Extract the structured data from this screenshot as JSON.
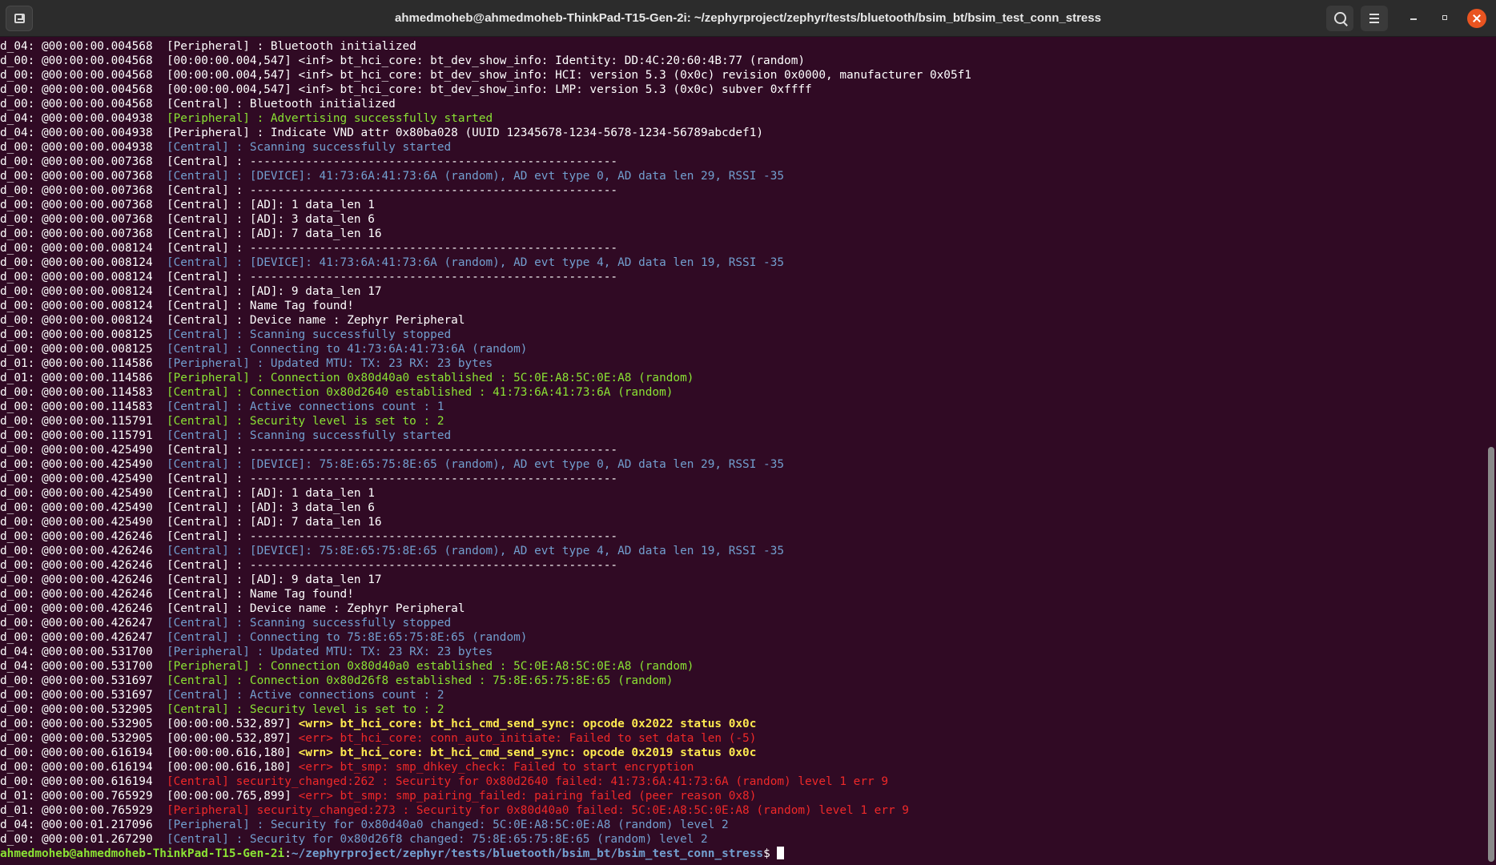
{
  "window": {
    "title": "ahmedmoheb@ahmedmoheb-ThinkPad-T15-Gen-2i: ~/zephyrproject/zephyr/tests/bluetooth/bsim_bt/bsim_test_conn_stress"
  },
  "icons": {
    "new_tab": "new-tab-icon",
    "search": "search-icon",
    "menu": "hamburger-menu-icon",
    "minimize": "minimize-icon",
    "maximize": "maximize-icon",
    "close": "close-icon"
  },
  "colors": {
    "background": "#300a24",
    "titlebar": "#2c2c2c",
    "green": "#8ae234",
    "blue": "#729fcf",
    "yellow": "#fce94f",
    "red": "#ef2929",
    "close_button": "#e95420"
  },
  "terminal": {
    "lines": [
      {
        "prefix": "d_04: @00:00:00.004568  ",
        "text": "[Peripheral] : Bluetooth initialized",
        "color": "white"
      },
      {
        "prefix": "d_00: @00:00:00.004568  ",
        "text": "[00:00:00.004,547] <inf> bt_hci_core: bt_dev_show_info: Identity: DD:4C:20:60:4B:77 (random)",
        "color": "white"
      },
      {
        "prefix": "d_00: @00:00:00.004568  ",
        "text": "[00:00:00.004,547] <inf> bt_hci_core: bt_dev_show_info: HCI: version 5.3 (0x0c) revision 0x0000, manufacturer 0x05f1",
        "color": "white"
      },
      {
        "prefix": "d_00: @00:00:00.004568  ",
        "text": "[00:00:00.004,547] <inf> bt_hci_core: bt_dev_show_info: LMP: version 5.3 (0x0c) subver 0xffff",
        "color": "white"
      },
      {
        "prefix": "d_00: @00:00:00.004568  ",
        "text": "[Central] : Bluetooth initialized",
        "color": "white"
      },
      {
        "prefix": "d_04: @00:00:00.004938  ",
        "text": "[Peripheral] : Advertising successfully started",
        "color": "green"
      },
      {
        "prefix": "d_04: @00:00:00.004938  ",
        "text": "[Peripheral] : Indicate VND attr 0x80ba028 (UUID 12345678-1234-5678-1234-56789abcdef1)",
        "color": "white"
      },
      {
        "prefix": "d_00: @00:00:00.004938  ",
        "text": "[Central] : Scanning successfully started",
        "color": "blue"
      },
      {
        "prefix": "d_00: @00:00:00.007368  ",
        "text": "[Central] : -----------------------------------------------------",
        "color": "white"
      },
      {
        "prefix": "d_00: @00:00:00.007368  ",
        "text": "[Central] : [DEVICE]: 41:73:6A:41:73:6A (random), AD evt type 0, AD data len 29, RSSI -35",
        "color": "blue"
      },
      {
        "prefix": "d_00: @00:00:00.007368  ",
        "text": "[Central] : -----------------------------------------------------",
        "color": "white"
      },
      {
        "prefix": "d_00: @00:00:00.007368  ",
        "text": "[Central] : [AD]: 1 data_len 1",
        "color": "white"
      },
      {
        "prefix": "d_00: @00:00:00.007368  ",
        "text": "[Central] : [AD]: 3 data_len 6",
        "color": "white"
      },
      {
        "prefix": "d_00: @00:00:00.007368  ",
        "text": "[Central] : [AD]: 7 data_len 16",
        "color": "white"
      },
      {
        "prefix": "d_00: @00:00:00.008124  ",
        "text": "[Central] : -----------------------------------------------------",
        "color": "white"
      },
      {
        "prefix": "d_00: @00:00:00.008124  ",
        "text": "[Central] : [DEVICE]: 41:73:6A:41:73:6A (random), AD evt type 4, AD data len 19, RSSI -35",
        "color": "blue"
      },
      {
        "prefix": "d_00: @00:00:00.008124  ",
        "text": "[Central] : -----------------------------------------------------",
        "color": "white"
      },
      {
        "prefix": "d_00: @00:00:00.008124  ",
        "text": "[Central] : [AD]: 9 data_len 17",
        "color": "white"
      },
      {
        "prefix": "d_00: @00:00:00.008124  ",
        "text": "[Central] : Name Tag found!",
        "color": "white"
      },
      {
        "prefix": "d_00: @00:00:00.008124  ",
        "text": "[Central] : Device name : Zephyr Peripheral",
        "color": "white"
      },
      {
        "prefix": "d_00: @00:00:00.008125  ",
        "text": "[Central] : Scanning successfully stopped",
        "color": "blue"
      },
      {
        "prefix": "d_00: @00:00:00.008125  ",
        "text": "[Central] : Connecting to 41:73:6A:41:73:6A (random)",
        "color": "blue"
      },
      {
        "prefix": "d_01: @00:00:00.114586  ",
        "text": "[Peripheral] : Updated MTU: TX: 23 RX: 23 bytes",
        "color": "blue"
      },
      {
        "prefix": "d_01: @00:00:00.114586  ",
        "text": "[Peripheral] : Connection 0x80d40a0 established : 5C:0E:A8:5C:0E:A8 (random)",
        "color": "green"
      },
      {
        "prefix": "d_00: @00:00:00.114583  ",
        "text": "[Central] : Connection 0x80d2640 established : 41:73:6A:41:73:6A (random)",
        "color": "green"
      },
      {
        "prefix": "d_00: @00:00:00.114583  ",
        "text": "[Central] : Active connections count : 1",
        "color": "blue"
      },
      {
        "prefix": "d_00: @00:00:00.115791  ",
        "text": "[Central] : Security level is set to : 2",
        "color": "green"
      },
      {
        "prefix": "d_00: @00:00:00.115791  ",
        "text": "[Central] : Scanning successfully started",
        "color": "blue"
      },
      {
        "prefix": "d_00: @00:00:00.425490  ",
        "text": "[Central] : -----------------------------------------------------",
        "color": "white"
      },
      {
        "prefix": "d_00: @00:00:00.425490  ",
        "text": "[Central] : [DEVICE]: 75:8E:65:75:8E:65 (random), AD evt type 0, AD data len 29, RSSI -35",
        "color": "blue"
      },
      {
        "prefix": "d_00: @00:00:00.425490  ",
        "text": "[Central] : -----------------------------------------------------",
        "color": "white"
      },
      {
        "prefix": "d_00: @00:00:00.425490  ",
        "text": "[Central] : [AD]: 1 data_len 1",
        "color": "white"
      },
      {
        "prefix": "d_00: @00:00:00.425490  ",
        "text": "[Central] : [AD]: 3 data_len 6",
        "color": "white"
      },
      {
        "prefix": "d_00: @00:00:00.425490  ",
        "text": "[Central] : [AD]: 7 data_len 16",
        "color": "white"
      },
      {
        "prefix": "d_00: @00:00:00.426246  ",
        "text": "[Central] : -----------------------------------------------------",
        "color": "white"
      },
      {
        "prefix": "d_00: @00:00:00.426246  ",
        "text": "[Central] : [DEVICE]: 75:8E:65:75:8E:65 (random), AD evt type 4, AD data len 19, RSSI -35",
        "color": "blue"
      },
      {
        "prefix": "d_00: @00:00:00.426246  ",
        "text": "[Central] : -----------------------------------------------------",
        "color": "white"
      },
      {
        "prefix": "d_00: @00:00:00.426246  ",
        "text": "[Central] : [AD]: 9 data_len 17",
        "color": "white"
      },
      {
        "prefix": "d_00: @00:00:00.426246  ",
        "text": "[Central] : Name Tag found!",
        "color": "white"
      },
      {
        "prefix": "d_00: @00:00:00.426246  ",
        "text": "[Central] : Device name : Zephyr Peripheral",
        "color": "white"
      },
      {
        "prefix": "d_00: @00:00:00.426247  ",
        "text": "[Central] : Scanning successfully stopped",
        "color": "blue"
      },
      {
        "prefix": "d_00: @00:00:00.426247  ",
        "text": "[Central] : Connecting to 75:8E:65:75:8E:65 (random)",
        "color": "blue"
      },
      {
        "prefix": "d_04: @00:00:00.531700  ",
        "text": "[Peripheral] : Updated MTU: TX: 23 RX: 23 bytes",
        "color": "blue"
      },
      {
        "prefix": "d_04: @00:00:00.531700  ",
        "text": "[Peripheral] : Connection 0x80d40a0 established : 5C:0E:A8:5C:0E:A8 (random)",
        "color": "green"
      },
      {
        "prefix": "d_00: @00:00:00.531697  ",
        "text": "[Central] : Connection 0x80d26f8 established : 75:8E:65:75:8E:65 (random)",
        "color": "green"
      },
      {
        "prefix": "d_00: @00:00:00.531697  ",
        "text": "[Central] : Active connections count : 2",
        "color": "blue"
      },
      {
        "prefix": "d_00: @00:00:00.532905  ",
        "text": "[Central] : Security level is set to : 2",
        "color": "green"
      },
      {
        "prefix": "d_00: @00:00:00.532905  ",
        "ts": "[00:00:00.532,897] ",
        "text": "<wrn> bt_hci_core: bt_hci_cmd_send_sync: opcode 0x2022 status 0x0c",
        "color": "yellow"
      },
      {
        "prefix": "d_00: @00:00:00.532905  ",
        "ts": "[00:00:00.532,897] ",
        "text": "<err> bt_hci_core: conn_auto_initiate: Failed to set data len (-5)",
        "color": "red"
      },
      {
        "prefix": "d_00: @00:00:00.616194  ",
        "ts": "[00:00:00.616,180] ",
        "text": "<wrn> bt_hci_core: bt_hci_cmd_send_sync: opcode 0x2019 status 0x0c",
        "color": "yellow"
      },
      {
        "prefix": "d_00: @00:00:00.616194  ",
        "ts": "[00:00:00.616,180] ",
        "text": "<err> bt_smp: smp_dhkey_check: Failed to start encryption",
        "color": "red"
      },
      {
        "prefix": "d_00: @00:00:00.616194  ",
        "text": "[Central] security_changed:262 : Security for 0x80d2640 failed: 41:73:6A:41:73:6A (random) level 1 err 9",
        "color": "red"
      },
      {
        "prefix": "d_01: @00:00:00.765929  ",
        "ts": "[00:00:00.765,899] ",
        "text": "<err> bt_smp: smp_pairing_failed: pairing failed (peer reason 0x8)",
        "color": "red"
      },
      {
        "prefix": "d_01: @00:00:00.765929  ",
        "text": "[Peripheral] security_changed:273 : Security for 0x80d40a0 failed: 5C:0E:A8:5C:0E:A8 (random) level 1 err 9",
        "color": "red"
      },
      {
        "prefix": "d_04: @00:00:01.217096  ",
        "text": "[Peripheral] : Security for 0x80d40a0 changed: 5C:0E:A8:5C:0E:A8 (random) level 2",
        "color": "blue"
      },
      {
        "prefix": "d_00: @00:00:01.267290  ",
        "text": "[Central] : Security for 0x80d26f8 changed: 75:8E:65:75:8E:65 (random) level 2",
        "color": "blue"
      }
    ],
    "prompt": {
      "user_host": "ahmedmoheb@ahmedmoheb-ThinkPad-T15-Gen-2i",
      "separator": ":",
      "path": "~/zephyrproject/zephyr/tests/bluetooth/bsim_bt/bsim_test_conn_stress",
      "symbol": "$ "
    }
  }
}
